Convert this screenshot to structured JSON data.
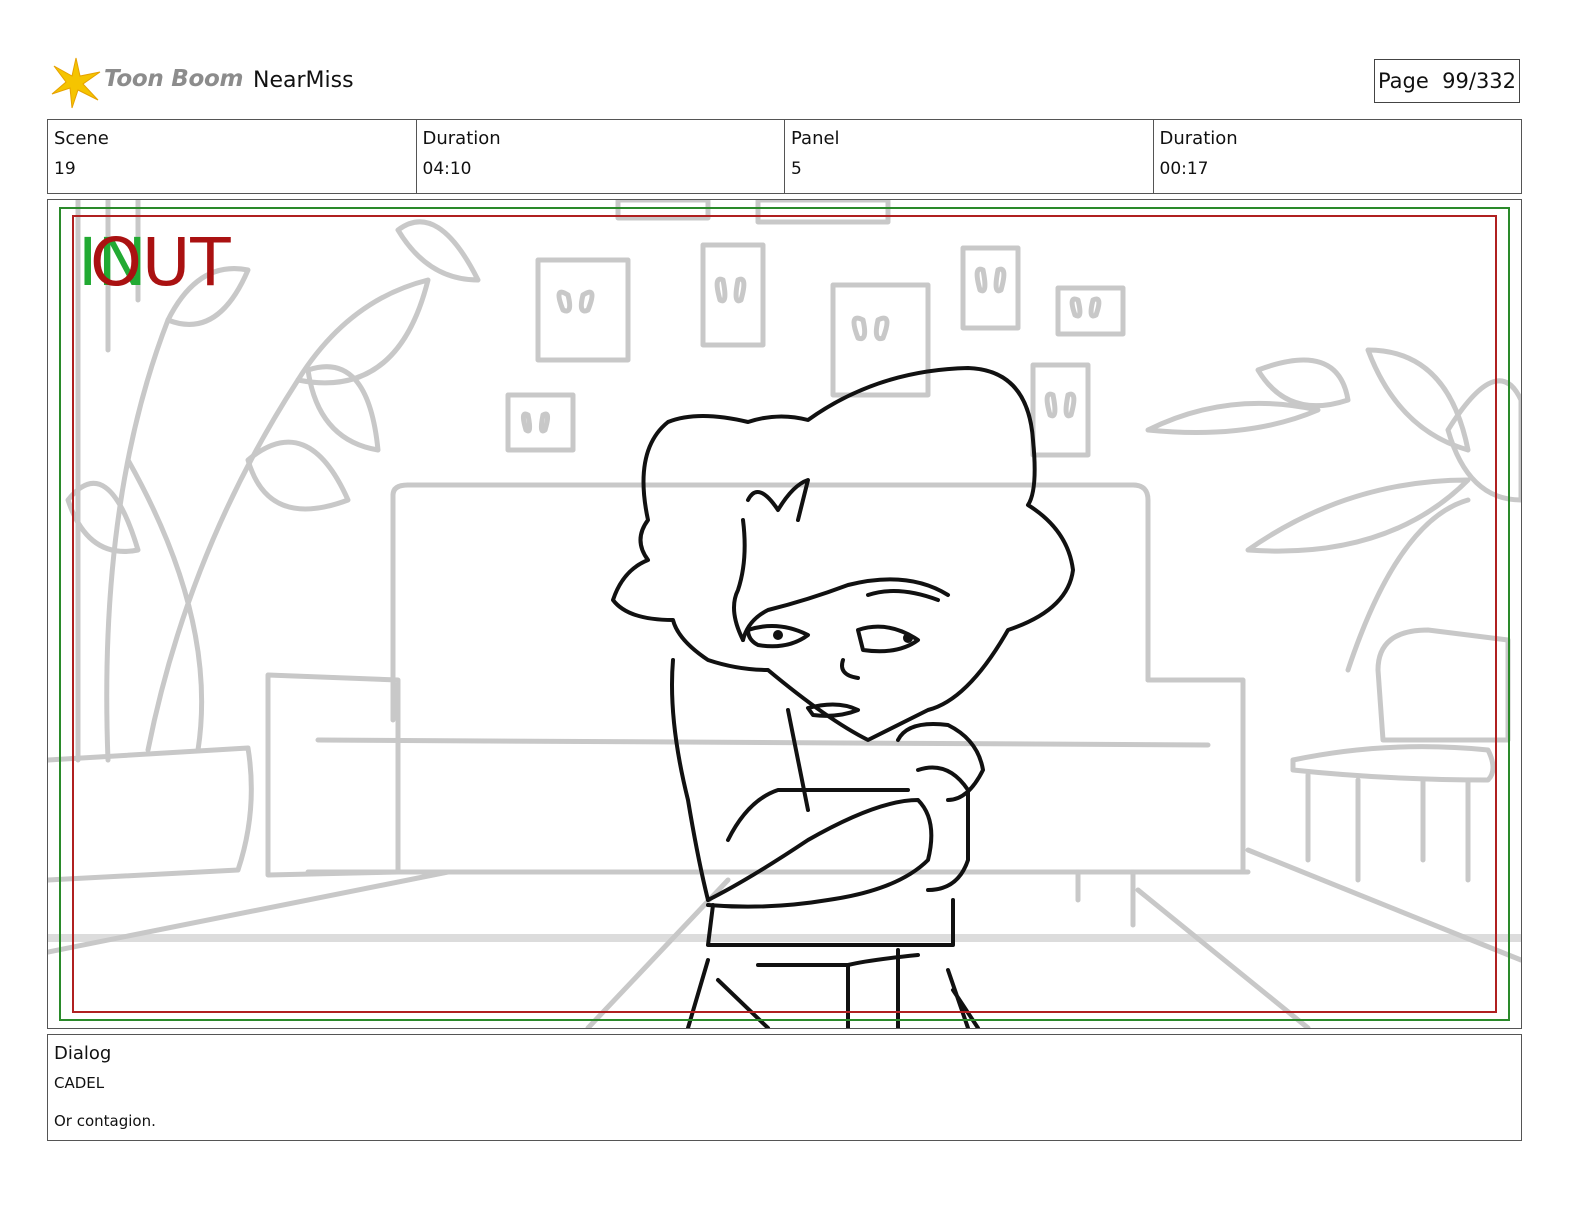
{
  "header": {
    "logo_text": "Toon Boom",
    "project": "NearMiss",
    "page_label": "Page  99/332"
  },
  "info": [
    {
      "label": "Scene",
      "value": "19"
    },
    {
      "label": "Duration",
      "value": "04:10"
    },
    {
      "label": "Panel",
      "value": "5"
    },
    {
      "label": "Duration",
      "value": "00:17"
    }
  ],
  "frame": {
    "in_label": "IN",
    "out_label": "OUT",
    "in_color": "#22aa33",
    "out_color": "#aa1111"
  },
  "dialog": {
    "label": "Dialog",
    "speaker": "CADEL",
    "line": "Or contagion."
  }
}
